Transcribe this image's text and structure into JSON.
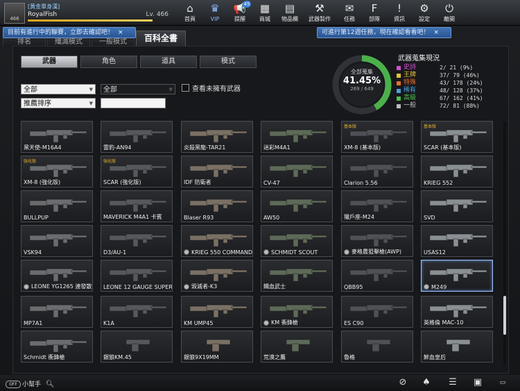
{
  "profile": {
    "guild": "[黃金單身漢]",
    "name": "RoyalFish",
    "level": "Lv. 466",
    "avatar_text": "466",
    "exp_fraction": 0.9
  },
  "nav": [
    {
      "label": "首頁",
      "icon": "home-icon",
      "glyph": "⌂"
    },
    {
      "label": "VIP",
      "icon": "crown-icon",
      "glyph": "♛"
    },
    {
      "label": "提醒",
      "icon": "megaphone-icon",
      "glyph": "📢",
      "badge": "45"
    },
    {
      "label": "商城",
      "icon": "store-icon",
      "glyph": "▦"
    },
    {
      "label": "物品欄",
      "icon": "briefcase-icon",
      "glyph": "▤"
    },
    {
      "label": "武器製作",
      "icon": "gun-craft-icon",
      "glyph": "⚒"
    },
    {
      "label": "任務",
      "icon": "ticket-icon",
      "glyph": "✉"
    },
    {
      "label": "部隊",
      "icon": "clan-icon",
      "glyph": "F"
    },
    {
      "label": "資訊",
      "icon": "info-icon",
      "glyph": "!"
    },
    {
      "label": "設定",
      "icon": "gear-icon",
      "glyph": "⚙"
    },
    {
      "label": "離開",
      "icon": "power-icon",
      "glyph": "⏻"
    }
  ],
  "notices": {
    "left": "目前有進行中的聯賽，立即去確認吧！",
    "right": "可進行第12週任務，現在確認看看吧！",
    "close": "×"
  },
  "main_tabs": [
    "排名",
    "殲滅模式",
    "一般模式",
    "百科全書"
  ],
  "sub_tabs": [
    "武器",
    "角色",
    "道具",
    "模式"
  ],
  "filters": {
    "category": "全部",
    "type": "全部",
    "sort": "推薦排序",
    "search_value": "",
    "unowned_label": "查看未擁有武器"
  },
  "collection": {
    "title": "武器蒐集現況",
    "donut_label": "全部蒐集",
    "percent": "41.45%",
    "count": "269 / 649",
    "fraction": 0.4145,
    "tiers": [
      {
        "name": "史詩",
        "color": "#d24fd0",
        "value": "2/  21  (9%)"
      },
      {
        "name": "王牌",
        "color": "#e6c23a",
        "value": "37/ 79  (46%)"
      },
      {
        "name": "特殊",
        "color": "#e86f2a",
        "value": "43/ 178 (24%)"
      },
      {
        "name": "稀有",
        "color": "#4aa0dc",
        "value": "48/ 128 (37%)"
      },
      {
        "name": "高級",
        "color": "#4cc04c",
        "value": "67/ 162 (41%)"
      },
      {
        "name": "一般",
        "color": "#bbbbbb",
        "value": "72/  81 (88%)"
      }
    ]
  },
  "weapons": [
    {
      "name": "黑天使-M16A4"
    },
    {
      "name": "雷豹-AN94"
    },
    {
      "name": "炎殺黑龍-TAR21"
    },
    {
      "name": "迷彩M4A1"
    },
    {
      "name": "XM-8 (基本版)",
      "tag": "基本版"
    },
    {
      "name": "SCAR (基本版)",
      "tag": "基本版"
    },
    {
      "name": "XM-8 (強化版)",
      "tag": "強化版"
    },
    {
      "name": "SCAR (強化版)",
      "tag": "強化版"
    },
    {
      "name": "IDF 防衛者"
    },
    {
      "name": "CV-47"
    },
    {
      "name": "Clarion 5.56"
    },
    {
      "name": "KRIEG 552"
    },
    {
      "name": "BULLPUP"
    },
    {
      "name": "MAVERICK M4A1 卡賓"
    },
    {
      "name": "Blaser R93"
    },
    {
      "name": "AW50"
    },
    {
      "name": "獵戶座-M24"
    },
    {
      "name": "SVD"
    },
    {
      "name": "VSK94"
    },
    {
      "name": "D3/AU-1"
    },
    {
      "name": "KRIEG 550 COMMANDO",
      "gold": true
    },
    {
      "name": "SCHMIDT SCOUT",
      "gold": true
    },
    {
      "name": "麥格農狙擊槍(AWP)",
      "gold": true
    },
    {
      "name": "USAS12"
    },
    {
      "name": "LEONE YG1265 連發散彈",
      "gold": true
    },
    {
      "name": "LEONE 12 GAUGE SUPER"
    },
    {
      "name": "毀滅者-K3",
      "gold": true
    },
    {
      "name": "鐵血武士"
    },
    {
      "name": "QBB95"
    },
    {
      "name": "M249",
      "gold": true,
      "selected": true
    },
    {
      "name": "MP7A1"
    },
    {
      "name": "K1A"
    },
    {
      "name": "KM UMP45"
    },
    {
      "name": "KM 衝鋒槍",
      "gold": true
    },
    {
      "name": "ES C90"
    },
    {
      "name": "英格倫 MAC-10"
    },
    {
      "name": "Schmidt 衝鋒槍"
    },
    {
      "name": "銀狼KM.45"
    },
    {
      "name": "銀狼9X19MM"
    },
    {
      "name": "荒漠之鷹"
    },
    {
      "name": "魯格"
    },
    {
      "name": "鮮血皇后"
    }
  ],
  "bottom": {
    "helper_label": "小幫手",
    "helper_pill": "OFF",
    "icons": [
      "compass-icon",
      "shooter-alert-icon",
      "checklist-icon",
      "calendar-icon",
      "screenshot-icon"
    ]
  }
}
